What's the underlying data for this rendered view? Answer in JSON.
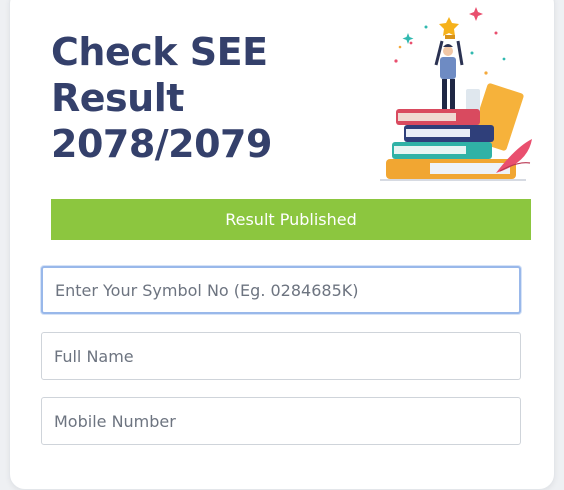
{
  "header": {
    "title_lines": [
      "Check SEE",
      "Result",
      "2078/2079"
    ]
  },
  "status": {
    "label": "Result Published",
    "color": "#8cc63f"
  },
  "form": {
    "symbol_no": {
      "placeholder": "Enter Your Symbol No (Eg. 0284685K)",
      "value": ""
    },
    "full_name": {
      "placeholder": "Full Name",
      "value": ""
    },
    "mobile_number": {
      "placeholder": "Mobile Number",
      "value": ""
    }
  },
  "illustration": {
    "icon": "student-holding-trophy-on-books-illustration"
  },
  "colors": {
    "title": "#34406b",
    "focus_border": "#99b8ea"
  }
}
